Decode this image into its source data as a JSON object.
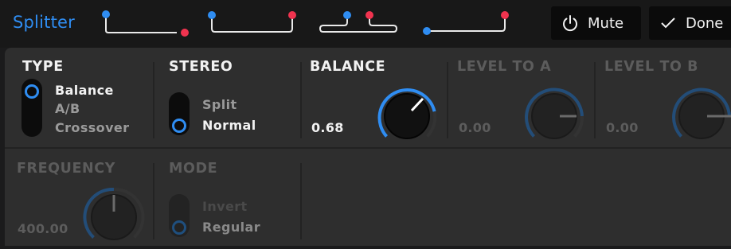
{
  "header": {
    "title": "Splitter",
    "mute_label": "Mute",
    "done_label": "Done",
    "colors": {
      "accent": "#2f8df2",
      "red": "#f0334f"
    },
    "routing_presets": [
      "balance-routing",
      "ab-routing",
      "crossover-routing",
      "normal-routing"
    ]
  },
  "type": {
    "heading": "TYPE",
    "options": [
      "Balance",
      "A/B",
      "Crossover"
    ],
    "selected": "Balance"
  },
  "stereo": {
    "heading": "STEREO",
    "options": [
      "Split",
      "Normal"
    ],
    "selected": "Normal"
  },
  "balance": {
    "heading": "BALANCE",
    "value": "0.68",
    "level": 0.68
  },
  "level_a": {
    "heading": "LEVEL TO A",
    "value": "0.00"
  },
  "level_b": {
    "heading": "LEVEL TO B",
    "value": "0.00"
  },
  "frequency": {
    "heading": "FREQUENCY",
    "value": "400.00"
  },
  "mode": {
    "heading": "MODE",
    "options": [
      "Invert",
      "Regular"
    ],
    "selected": "Regular"
  }
}
